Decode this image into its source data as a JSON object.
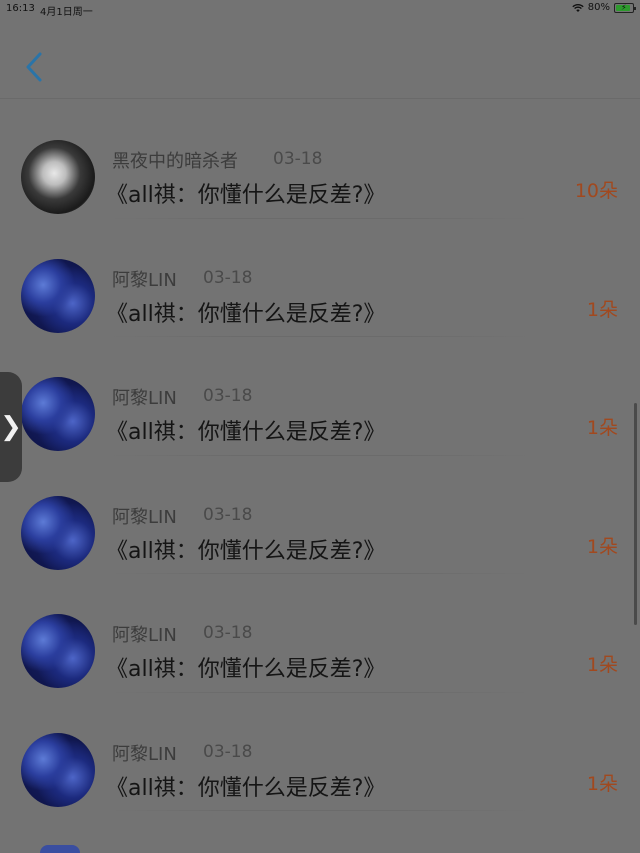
{
  "status_bar": {
    "time": "16:13",
    "date": "4月1日周一",
    "battery": "80%",
    "battery_level": 0.8,
    "wifi_icon": "wifi-icon",
    "battery_icon": "battery-charging-icon"
  },
  "nav": {
    "back_icon": "chevron-left-icon",
    "accent": "#2a74a8"
  },
  "side_handle": {
    "icon": "chevron-right-icon",
    "glyph": "❯"
  },
  "items": [
    {
      "author": "黑夜中的暗杀者",
      "date": "03-18",
      "title": "《all祺：你懂什么是反差?》",
      "count": "10朵",
      "avatar": "dark"
    },
    {
      "author": "阿黎LIN",
      "date": "03-18",
      "title": "《all祺：你懂什么是反差?》",
      "count": "1朵",
      "avatar": "blue"
    },
    {
      "author": "阿黎LIN",
      "date": "03-18",
      "title": "《all祺：你懂什么是反差?》",
      "count": "1朵",
      "avatar": "blue"
    },
    {
      "author": "阿黎LIN",
      "date": "03-18",
      "title": "《all祺：你懂什么是反差?》",
      "count": "1朵",
      "avatar": "blue"
    },
    {
      "author": "阿黎LIN",
      "date": "03-18",
      "title": "《all祺：你懂什么是反差?》",
      "count": "1朵",
      "avatar": "blue"
    },
    {
      "author": "阿黎LIN",
      "date": "03-18",
      "title": "《all祺：你懂什么是反差?》",
      "count": "1朵",
      "avatar": "blue"
    }
  ],
  "colors": {
    "count": "#a1491f",
    "overlay": "#737373"
  }
}
